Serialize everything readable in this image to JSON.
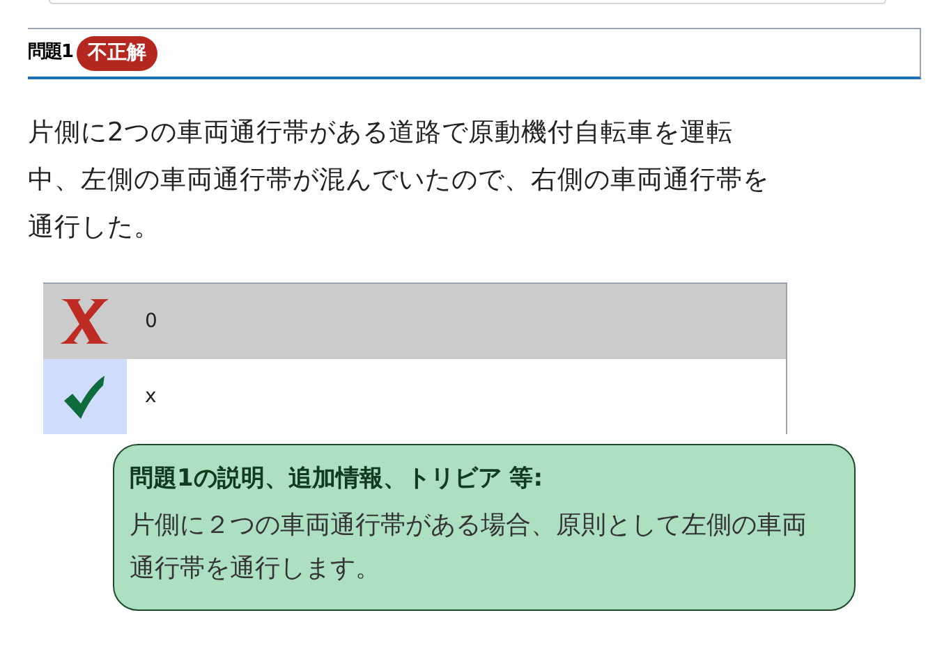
{
  "question": {
    "number": "問題1",
    "result_badge": "不正解",
    "correct": false,
    "text": "片側に2つの車両通行帯がある道路で原動機付自転車を運転中、左側の車両通行帯が混んでいたので、右側の車両通行帯を通行した。"
  },
  "options": [
    {
      "label": "0",
      "selected": true,
      "correct": false
    },
    {
      "label": "x",
      "selected": false,
      "correct": true
    }
  ],
  "explanation": {
    "title": "問題1の説明、追加情報、トリビア 等:",
    "text": "片側に２つの車両通行帯がある場合、原則として左側の車両通行帯を通行します。"
  }
}
